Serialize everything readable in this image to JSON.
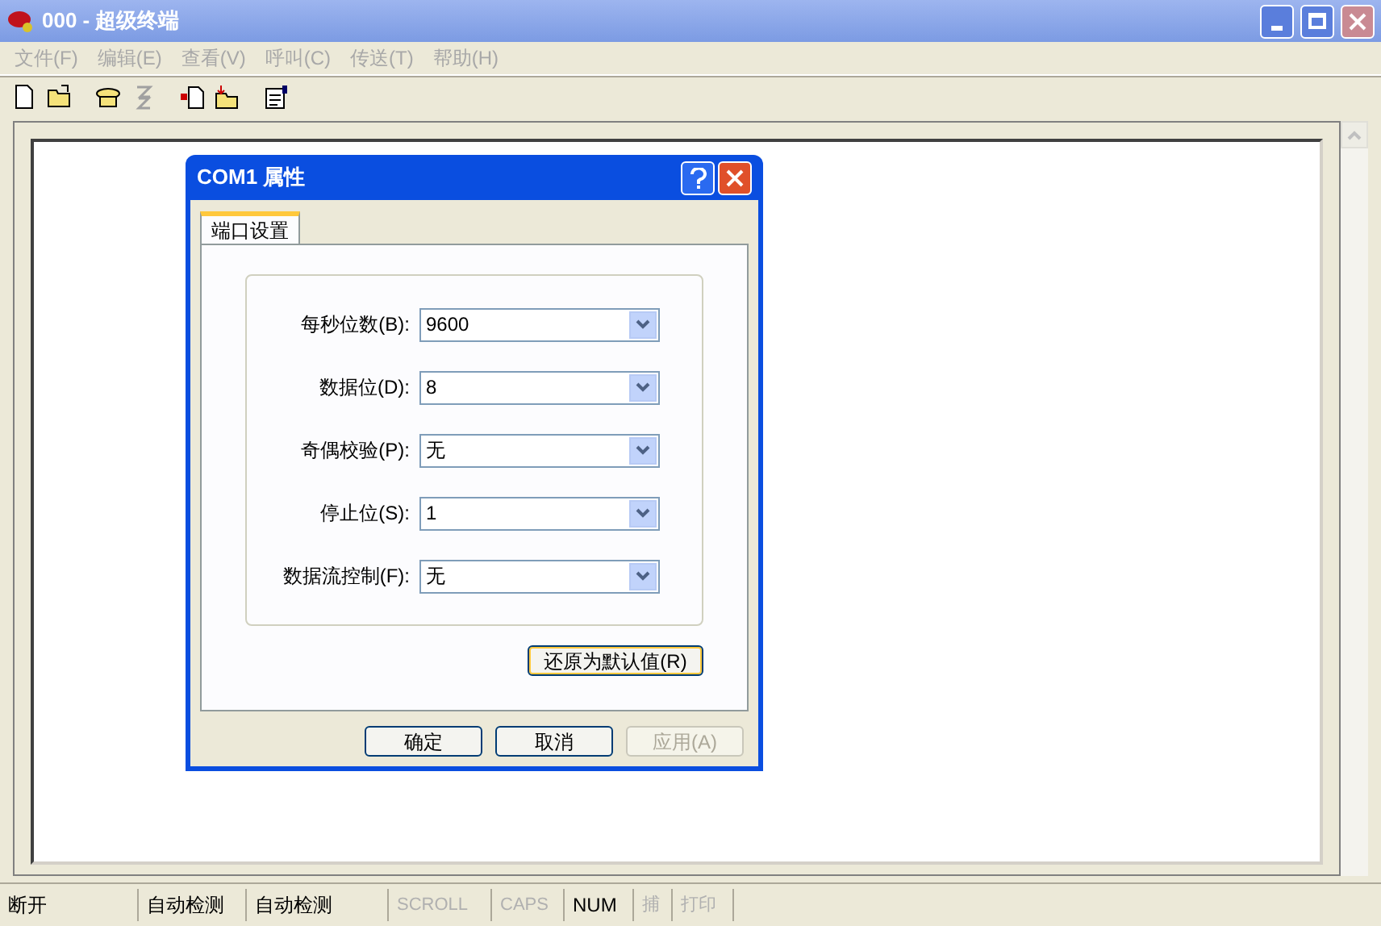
{
  "window": {
    "title": "000 - 超级终端"
  },
  "menu": [
    {
      "label": "文件(F)",
      "disabled": true
    },
    {
      "label": "编辑(E)",
      "disabled": true
    },
    {
      "label": "查看(V)",
      "disabled": true
    },
    {
      "label": "呼叫(C)",
      "disabled": true
    },
    {
      "label": "传送(T)",
      "disabled": true
    },
    {
      "label": "帮助(H)",
      "disabled": true
    }
  ],
  "toolbar": [
    {
      "kind": "new",
      "disabled": false
    },
    {
      "kind": "open",
      "disabled": false
    },
    {
      "kind": "call",
      "disabled": false
    },
    {
      "kind": "hangup",
      "disabled": true
    },
    {
      "kind": "send",
      "disabled": false
    },
    {
      "kind": "receive",
      "disabled": false
    },
    {
      "kind": "properties",
      "disabled": false
    }
  ],
  "dialog": {
    "title": "COM1 属性",
    "tabs": [
      {
        "label": "端口设置",
        "selected": true
      }
    ],
    "fields": [
      {
        "label": "每秒位数(B):",
        "value": "9600"
      },
      {
        "label": "数据位(D):",
        "value": "8"
      },
      {
        "label": "奇偶校验(P):",
        "value": "无"
      },
      {
        "label": "停止位(S):",
        "value": "1"
      },
      {
        "label": "数据流控制(F):",
        "value": "无"
      }
    ],
    "restore_button": "还原为默认值(R)",
    "buttons": [
      {
        "label": "确定",
        "disabled": false
      },
      {
        "label": "取消",
        "disabled": false
      },
      {
        "label": "应用(A)",
        "disabled": true
      }
    ]
  },
  "status_bar": [
    {
      "text": "断开",
      "disabled": false
    },
    {
      "text": "自动检测",
      "disabled": false
    },
    {
      "text": "自动检测",
      "disabled": false
    },
    {
      "text": "SCROLL",
      "disabled": true
    },
    {
      "text": "CAPS",
      "disabled": true
    },
    {
      "text": "NUM",
      "disabled": false
    },
    {
      "text": "捕",
      "disabled": true
    },
    {
      "text": "打印",
      "disabled": true
    }
  ]
}
